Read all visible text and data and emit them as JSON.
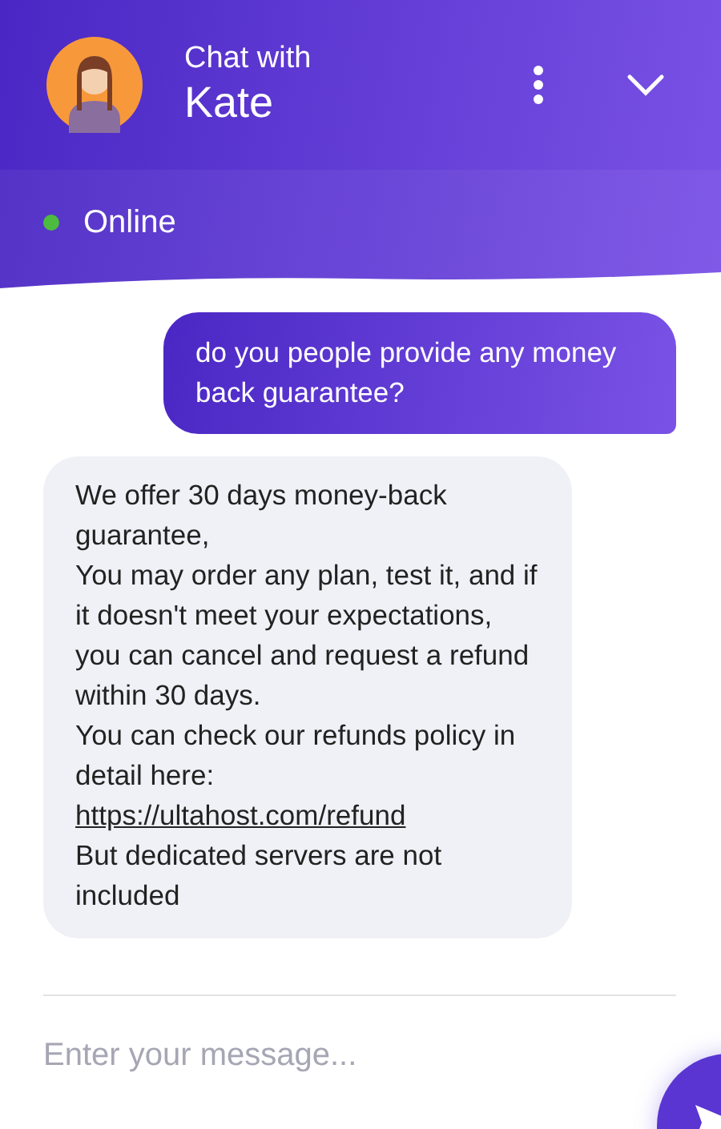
{
  "header": {
    "subtitle": "Chat with",
    "agent_name": "Kate"
  },
  "status": {
    "label": "Online",
    "color": "#4cbb3f"
  },
  "messages": [
    {
      "kind": "user",
      "lines": [
        {
          "kind": "text",
          "text": "do you people provide any money back guarantee?"
        }
      ]
    },
    {
      "kind": "agent",
      "lines": [
        {
          "kind": "text",
          "text": "We offer 30 days money-back guarantee,"
        },
        {
          "kind": "text",
          "text": "You may order any plan, test it, and if it doesn't meet your expectations, you can cancel and request a refund within 30 days."
        },
        {
          "kind": "text",
          "text": "You can check our refunds policy in detail here:"
        },
        {
          "kind": "link",
          "text": "https://ultahost.com/refund"
        },
        {
          "kind": "text",
          "text": "But dedicated servers are not included"
        }
      ]
    }
  ],
  "composer": {
    "placeholder": "Enter your message..."
  }
}
